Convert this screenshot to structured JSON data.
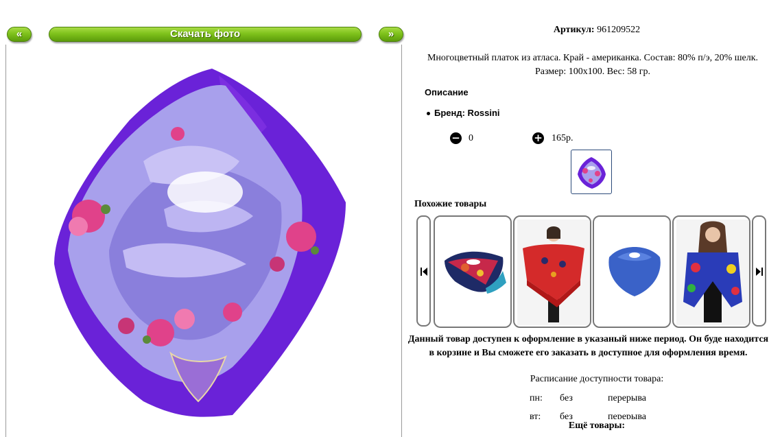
{
  "nav": {
    "prev_label": "«",
    "download_label": "Скачать фото",
    "next_label": "»"
  },
  "product": {
    "sku_label": "Артикул:",
    "sku_value": "961209522",
    "description": "Многоцветный платок из атласа. Край - американка. Состав: 80% п/э, 20% шелк. Размер: 100х100. Вес: 58 гр.",
    "section_description": "Описание",
    "brand_line": "Бренд: Rossini",
    "quantity": "0",
    "price": "165р."
  },
  "similar": {
    "title": "Похожие товары",
    "items": [
      {
        "name": "scarf-navy-floral"
      },
      {
        "name": "shawl-red-fringe"
      },
      {
        "name": "scarf-blue"
      },
      {
        "name": "scarf-multicolor"
      }
    ]
  },
  "availability": {
    "note": "Данный товар доступен к оформление в указаный ниже период. Он буде находится в корзине и Вы сможете его заказать в доступное для оформления время.",
    "schedule_title": "Расписание доступности товара:",
    "schedule": [
      {
        "day": "пн:",
        "from": "без",
        "to": "перерыва"
      },
      {
        "day": "вт:",
        "from": "без",
        "to": "перерыва"
      }
    ]
  },
  "more": {
    "title": "Ещё товары:"
  },
  "colors": {
    "button_green": "#7fc21c",
    "scarf_purple": "#6a22d8",
    "scarf_lavender": "#a8a0ec",
    "scarf_pink": "#e0428a",
    "link_green": "#2a8a2a"
  }
}
